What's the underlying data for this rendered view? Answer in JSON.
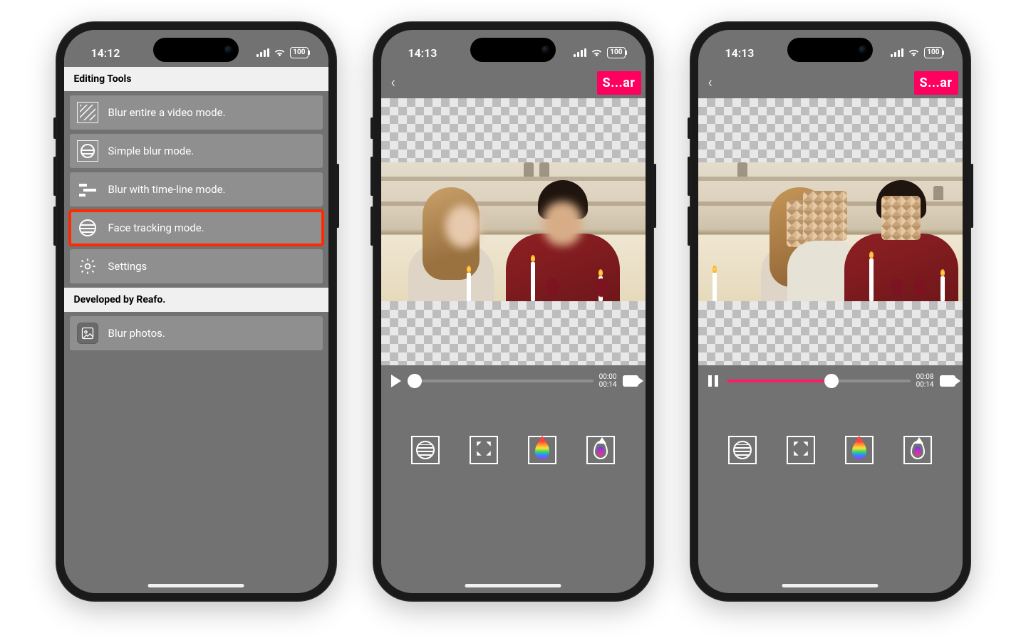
{
  "statusbars": {
    "s1": {
      "time": "14:12",
      "battery": "100"
    },
    "s2": {
      "time": "14:13",
      "battery": "100"
    },
    "s3": {
      "time": "14:13",
      "battery": "100"
    }
  },
  "screen1": {
    "section_tools": "Editing Tools",
    "items": {
      "blur_video": "Blur entire a video mode.",
      "simple_blur": "Simple blur mode.",
      "timeline": "Blur with time-line mode.",
      "face_track": "Face tracking mode.",
      "settings": "Settings"
    },
    "section_dev": "Developed by Reafo.",
    "blur_photos": "Blur photos."
  },
  "editor": {
    "top_button": "S...ar",
    "s2": {
      "current": "00:00",
      "total": "00:14",
      "progress_pct": 3
    },
    "s3": {
      "current": "00:08",
      "total": "00:14",
      "progress_pct": 57
    }
  }
}
